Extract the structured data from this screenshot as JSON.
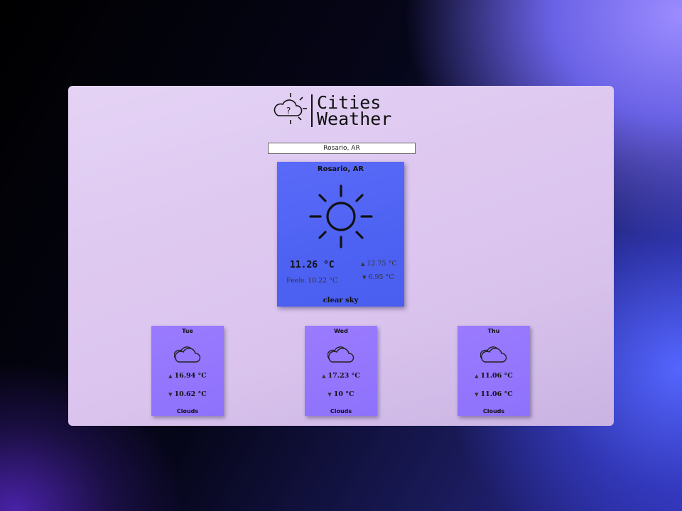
{
  "app": {
    "title_line1": "Cities",
    "title_line2": "Weather"
  },
  "search": {
    "value": "Rosario, AR"
  },
  "current": {
    "city": "Rosario, AR",
    "icon": "sun-icon",
    "temp": "11.26 °C",
    "feels_label": "Feels:",
    "feels_value": "10.22 °C",
    "max": "12.75 °C",
    "min": "6.95 °C",
    "description": "clear sky"
  },
  "forecast": [
    {
      "day": "Tue",
      "icon": "cloud-icon",
      "max": "16.94 °C",
      "min": "10.62 °C",
      "description": "Clouds"
    },
    {
      "day": "Wed",
      "icon": "cloud-icon",
      "max": "17.23 °C",
      "min": "10 °C",
      "description": "Clouds"
    },
    {
      "day": "Thu",
      "icon": "cloud-icon",
      "max": "11.06 °C",
      "min": "11.06 °C",
      "description": "Clouds"
    }
  ],
  "colors": {
    "panel": "#dcc6ef",
    "main_card": "#4d62f2",
    "forecast_card": "#8e72fb"
  }
}
